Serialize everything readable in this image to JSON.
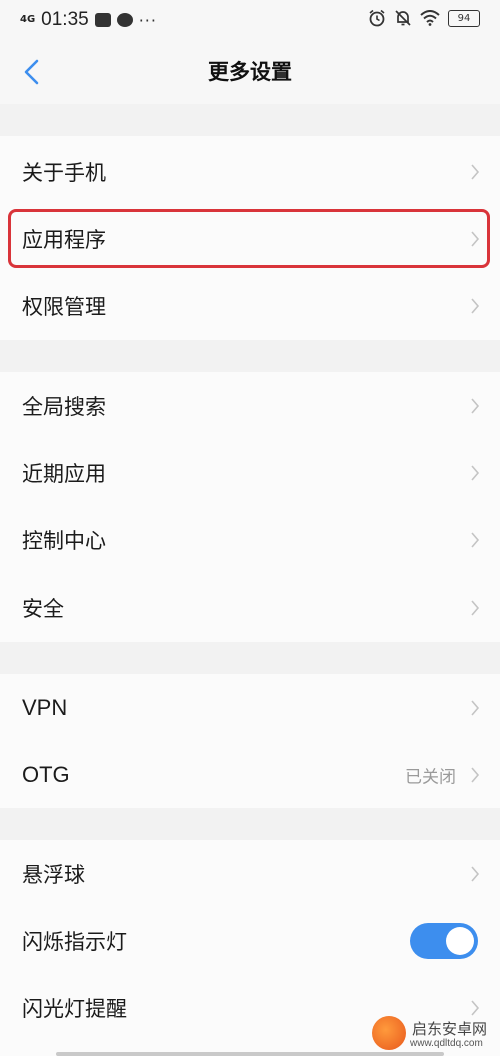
{
  "status_bar": {
    "signal": "4G",
    "time": "01:35",
    "more": "···",
    "battery": "94"
  },
  "header": {
    "title": "更多设置"
  },
  "groups": [
    {
      "items": [
        {
          "label": "关于手机"
        },
        {
          "label": "应用程序",
          "highlighted": true
        },
        {
          "label": "权限管理"
        }
      ]
    },
    {
      "items": [
        {
          "label": "全局搜索"
        },
        {
          "label": "近期应用"
        },
        {
          "label": "控制中心"
        },
        {
          "label": "安全"
        }
      ]
    },
    {
      "items": [
        {
          "label": "VPN"
        },
        {
          "label": "OTG",
          "value": "已关闭"
        }
      ]
    },
    {
      "items": [
        {
          "label": "悬浮球"
        },
        {
          "label": "闪烁指示灯",
          "toggle": true
        },
        {
          "label": "闪光灯提醒"
        }
      ]
    }
  ],
  "colors": {
    "accent": "#3d8eee",
    "highlight_border": "#d9343a",
    "background": "#f2f2f2",
    "row_background": "#fbfbfb"
  },
  "watermark": {
    "name": "启东安卓网",
    "url": "www.qdltdq.com"
  }
}
